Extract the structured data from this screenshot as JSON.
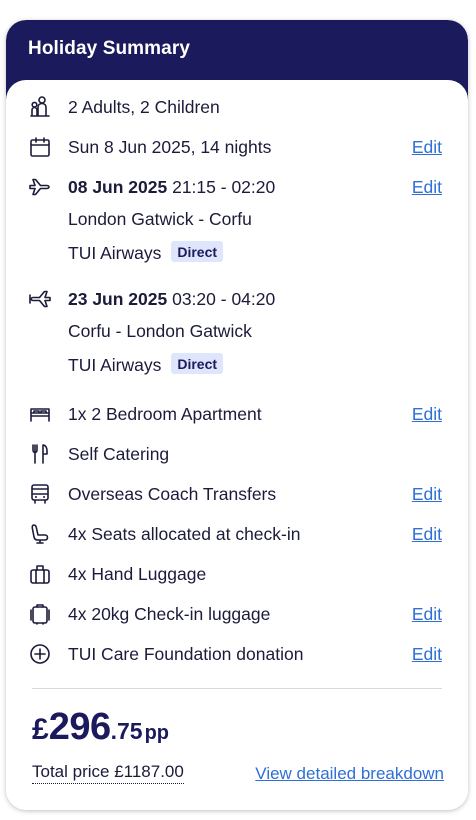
{
  "header": {
    "title": "Holiday Summary"
  },
  "summary": {
    "travellers": {
      "text": "2 Adults, 2 Children",
      "icon": "people-icon"
    },
    "dates": {
      "text": "Sun 8 Jun 2025, 14 nights",
      "edit": "Edit",
      "icon": "calendar-icon"
    },
    "outbound": {
      "date": "08 Jun 2025",
      "times": " 21:15 - 02:20",
      "route": "London Gatwick - Corfu",
      "airline": "TUI Airways",
      "badge": "Direct",
      "edit": "Edit",
      "icon": "plane-departure-icon"
    },
    "inbound": {
      "date": "23 Jun 2025",
      "times": " 03:20 - 04:20",
      "route": "Corfu - London Gatwick",
      "airline": "TUI Airways",
      "badge": "Direct",
      "icon": "plane-return-icon"
    },
    "room": {
      "text": "1x 2 Bedroom Apartment",
      "edit": "Edit",
      "icon": "bed-icon"
    },
    "board": {
      "text": "Self Catering",
      "icon": "cutlery-icon"
    },
    "transfers": {
      "text": "Overseas Coach Transfers",
      "edit": "Edit",
      "icon": "bus-icon"
    },
    "seats": {
      "text": "4x Seats allocated at check-in",
      "edit": "Edit",
      "icon": "seat-icon"
    },
    "hand_luggage": {
      "text": "4x Hand Luggage",
      "icon": "hand-luggage-icon"
    },
    "checkin_luggage": {
      "text": "4x 20kg Check-in luggage",
      "edit": "Edit",
      "icon": "suitcase-icon"
    },
    "donation": {
      "text": "TUI Care Foundation donation",
      "edit": "Edit",
      "icon": "plus-circle-icon"
    }
  },
  "price": {
    "currency": "£",
    "whole": "296",
    "decimal": ".75",
    "suffix": "pp",
    "total": "Total price £1187.00",
    "breakdown_link": "View detailed breakdown"
  },
  "colors": {
    "header_bg": "#1a1a5c",
    "link": "#2f6fd6",
    "badge_bg": "#dfe6fb"
  }
}
